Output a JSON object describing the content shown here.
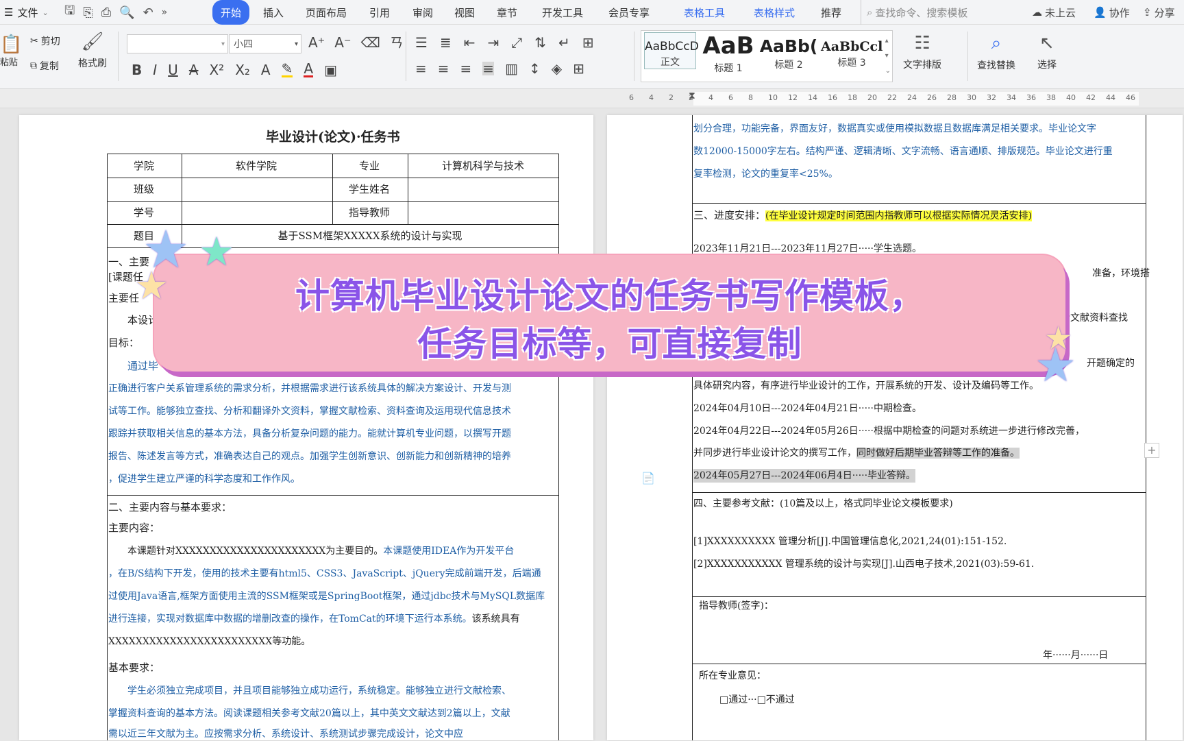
{
  "menubar": {
    "file": "文件",
    "tabs": [
      "开始",
      "插入",
      "页面布局",
      "引用",
      "审阅",
      "视图",
      "章节",
      "开发工具",
      "会员专享"
    ],
    "context_tabs": [
      "表格工具",
      "表格样式"
    ],
    "recommend": "推荐",
    "search_placeholder": "查找命令、搜索模板",
    "cloud": "未上云",
    "collab": "协作",
    "share": "分享"
  },
  "ribbon": {
    "paste": "粘贴",
    "cut": "剪切",
    "copy": "复制",
    "format_painter": "格式刷",
    "font_name": "",
    "font_size": "小四",
    "styles": [
      {
        "sample": "AaBbCcD",
        "label": "正文"
      },
      {
        "sample": "AaB",
        "label": "标题 1"
      },
      {
        "sample": "AaBb(",
        "label": "标题 2"
      },
      {
        "sample": "AaBbCcl",
        "label": "标题 3"
      }
    ],
    "text_layout": "文字排版",
    "find_replace": "查找替换",
    "select": "选择"
  },
  "ruler": {
    "ticks": [
      "6",
      "4",
      "2",
      "2",
      "4",
      "6",
      "8",
      "10",
      "12",
      "14",
      "16",
      "18",
      "20",
      "22",
      "24",
      "26",
      "28",
      "30",
      "32",
      "34",
      "36",
      "38",
      "40",
      "42",
      "44",
      "46"
    ]
  },
  "doc": {
    "title": "毕业设计(论文)·任务书",
    "table": {
      "r1": [
        "学院",
        "软件学院",
        "专业",
        "计算机科学与技术"
      ],
      "r2": [
        "班级",
        "",
        "学生姓名",
        ""
      ],
      "r3": [
        "学号",
        "",
        "指导教师",
        ""
      ],
      "r4": [
        "题目",
        "基于SSM框架XXXXX系统的设计与实现"
      ]
    },
    "left_lines": [
      "一、主要",
      "[课题任",
      "主要任",
      "本设计",
      "目标：",
      "通过毕",
      "正确进行客户关系管理系统的需求分析，并根据需求进行该系统具体的解决方案设计、开发与测",
      "试等工作。能够独立查找、分析和翻译外文资料，掌握文献检索、资料查询及运用现代信息技术",
      "跟踪并获取相关信息的基本方法，具备分析复杂问题的能力。能就计算机专业问题，以撰写开题",
      "报告、陈述发言等方式，准确表达自己的观点。加强学生创新意识、创新能力和创新精神的培养",
      "，促进学生建立严谨的科学态度和工作作风。"
    ],
    "section2": "二、主要内容与基本要求：",
    "main_content": "主要内容：",
    "mc1a": "本课题针对XXXXXXXXXXXXXXXXXXXXXX为主要目的。",
    "mc1b": "本课题使用IDEA作为开发平台",
    "mc2": "，在B/S结构下开发，使用的技术主要有html5、CSS3、JavaScript、jQuery完成前端开发，后端通",
    "mc3": "过使用Java语言,框架方面使用主流的SSM框架或是SpringBoot框架，通过jdbc技术与MySQL数据库",
    "mc4a": "进行连接，实现对数据库中数据的增删改查的操作，在TomCat的环境下运行本系统。",
    "mc4b": "该系统具有",
    "mc5": "XXXXXXXXXXXXXXXXXXXXXXXX等功能。",
    "basic_req": "基本要求：",
    "br1": "学生必须独立完成项目，并且项目能够独立成功运行，系统稳定。能够独立进行文献检索、",
    "br2": "掌握资料查询的基本方法。阅读课题相关参考文献20篇以上，其中英文文献达到2篇以上，文献",
    "br3": "需以近三年文献为主。应按需求分析、系统设计、系统测试步骤完成设计，论文中应",
    "right_top": [
      "划分合理，功能完备，界面友好，数据真实或使用模拟数据且数据库满足相关要求。毕业论文字",
      "数12000-15000字左右。结构严谨、逻辑清晰、文字流畅、语言通顺、排版规范。毕业论文进行重",
      "复率检测，论文的重复率<25%。"
    ],
    "section3": "三、进度安排：",
    "section3_note": "(在毕业设计规定时间范围内指教师可以根据实际情况灵活安排)",
    "sched1": "2023年11月21日---2023年11月27日·····学生选题。",
    "sched_frag1": "准备，环境搭",
    "sched_frag2": "行文献资料查找",
    "sched_frag3": "开题确定的",
    "sched4": "具体研究内容，有序进行毕业设计的工作，开展系统的开发、设计及编码等工作。",
    "sched5": "2024年04月10日---2024年04月21日·····中期检查。",
    "sched6": "2024年04月22日---2024年05月26日·····根据中期检查的问题对系统进一步进行修改完善，",
    "sched7a": "并同步进行毕业设计论文的撰写工作，",
    "sched7b": "同时做好后期毕业答辩等工作的准备。",
    "sched8": "2024年05月27日---2024年06月4日·····毕业答辩。",
    "section4": "四、主要参考文献：(10篇及以上，格式同毕业论文模板要求)",
    "ref1": "[1]XXXXXXXXXX 管理分析[J].中国管理信息化,2021,24(01):151-152.",
    "ref2": "[2]XXXXXXXXXXX 管理系统的设计与实现[J].山西电子技术,2021(03):59-61.",
    "advisor_sign": "指导教师(签字)：",
    "date": "年······月······日",
    "major_opinion": "所在专业意见：",
    "pass_options": "□通过···□不通过"
  },
  "banner": {
    "line1": "计算机毕业设计论文的任务书写作模板，",
    "line2": "任务目标等，可直接复制"
  }
}
